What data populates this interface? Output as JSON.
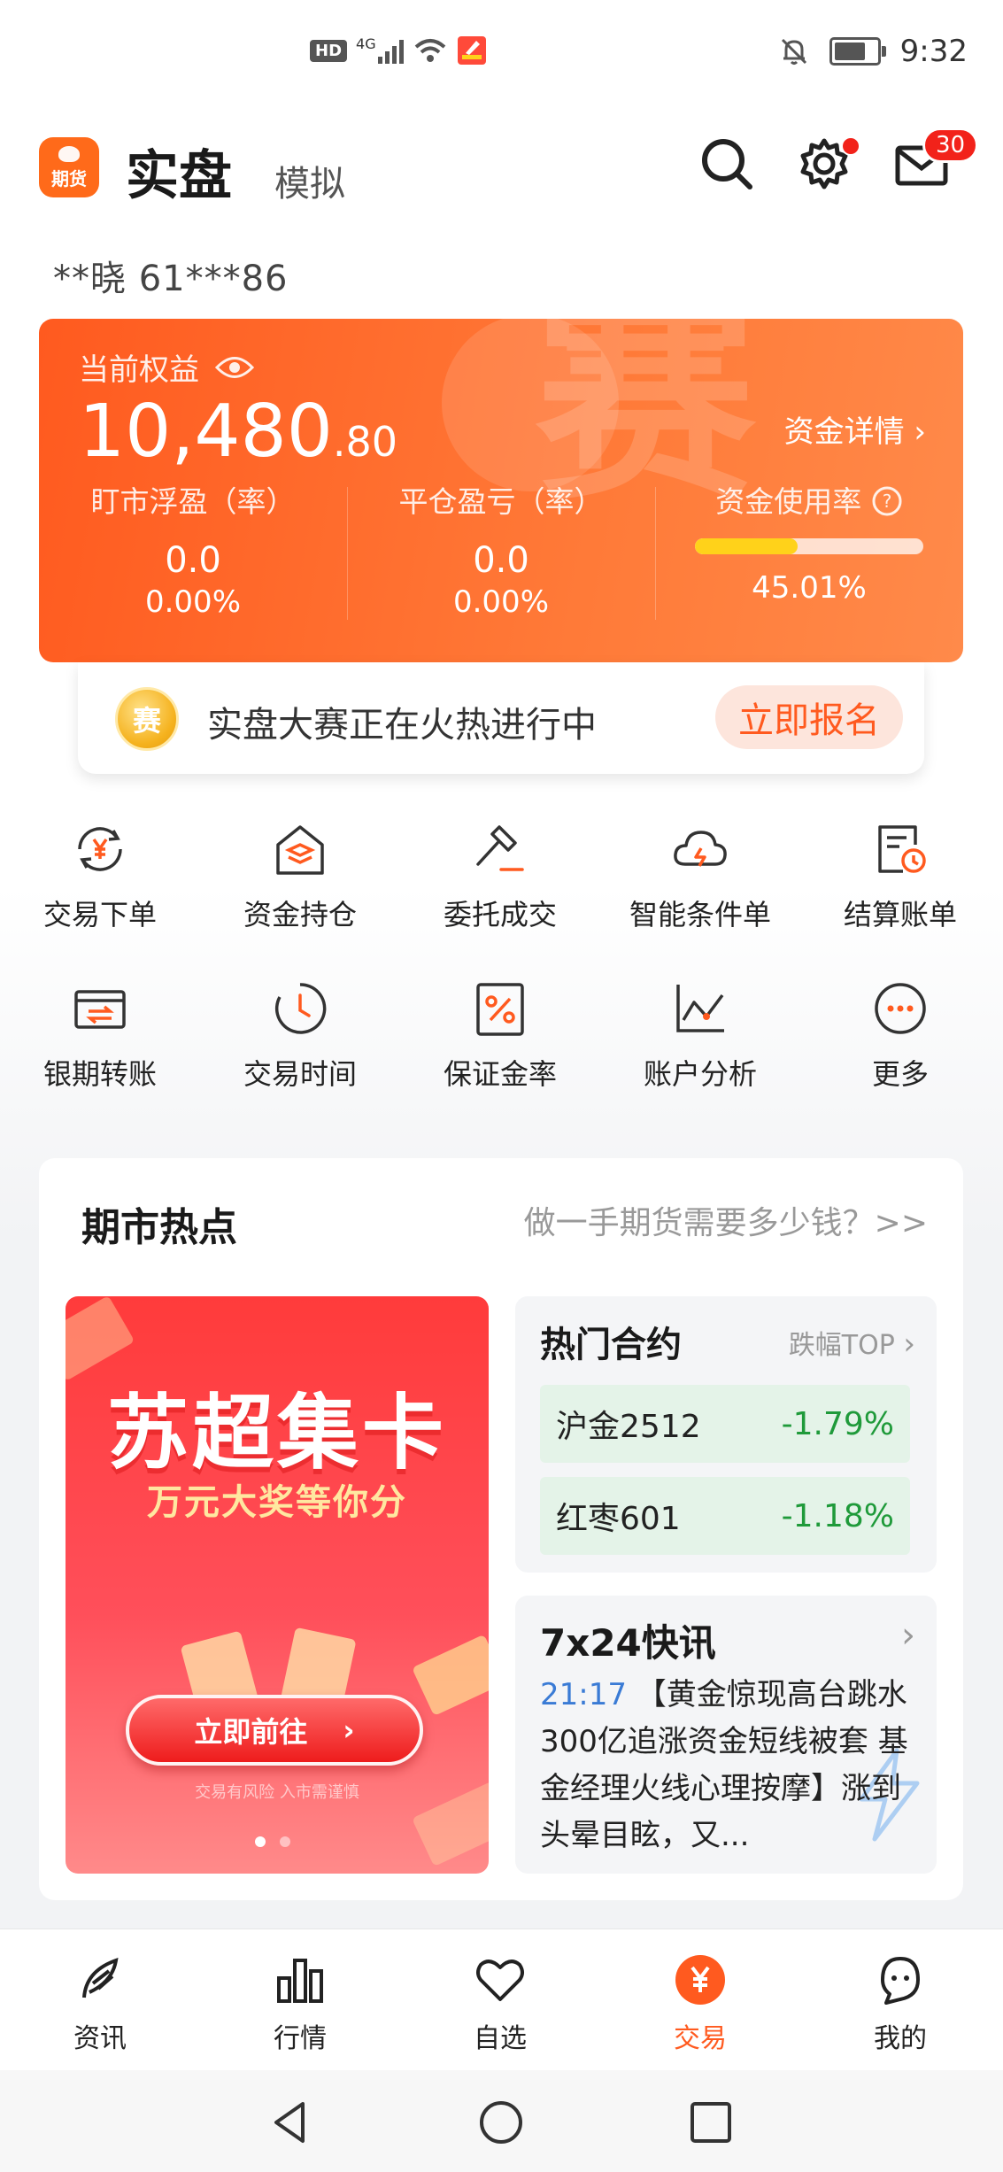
{
  "status_bar": {
    "time": "9:32",
    "hd": "HD",
    "net": "4G"
  },
  "header": {
    "logo_text": "期货",
    "tab_live": "实盘",
    "tab_sim": "模拟",
    "mail_badge": "30"
  },
  "account": "**晓  61***86",
  "equity": {
    "label": "当前权益",
    "value_int": "10,480",
    "value_dec": ".80",
    "detail_link": "资金详情 ›",
    "watermark": "赛",
    "float_pl_label": "盯市浮盈（率）",
    "float_pl_value": "0.0",
    "float_pl_rate": "0.00%",
    "close_pl_label": "平仓盈亏（率）",
    "close_pl_value": "0.0",
    "close_pl_rate": "0.00%",
    "usage_label": "资金使用率",
    "usage_value": "45.01%",
    "usage_fraction": 0.4501
  },
  "contest": {
    "medal": "赛",
    "message": "实盘大赛正在火热进行中",
    "button": "立即报名"
  },
  "shortcuts": [
    {
      "label": "交易下单",
      "icon": "yuan-exchange-icon"
    },
    {
      "label": "资金持仓",
      "icon": "house-layers-icon"
    },
    {
      "label": "委托成交",
      "icon": "gavel-icon"
    },
    {
      "label": "智能条件单",
      "icon": "cloud-lightning-icon"
    },
    {
      "label": "结算账单",
      "icon": "bill-clock-icon"
    },
    {
      "label": "银期转账",
      "icon": "card-transfer-icon"
    },
    {
      "label": "交易时间",
      "icon": "clock-icon"
    },
    {
      "label": "保证金率",
      "icon": "percent-icon"
    },
    {
      "label": "账户分析",
      "icon": "chart-line-icon"
    },
    {
      "label": "更多",
      "icon": "more-icon"
    }
  ],
  "hot_panel": {
    "title": "期市热点",
    "question": "做一手期货需要多少钱？>>",
    "banner": {
      "headline": "苏超集卡",
      "subline": "万元大奖等你分",
      "button": "立即前往",
      "disclaimer": "交易有风险 入市需谨慎"
    },
    "hot_contracts": {
      "title": "热门合约",
      "top_link": "跌幅TOP",
      "rows": [
        {
          "name": "沪金2512",
          "change": "-1.79%"
        },
        {
          "name": "红枣601",
          "change": "-1.18%"
        }
      ]
    },
    "news": {
      "title": "7x24快讯",
      "time": "21:17",
      "text": "【黄金惊现高台跳水 300亿追涨资金短线被套 基金经理火线心理按摩】涨到头晕目眩，又..."
    }
  },
  "bottom_nav": [
    {
      "label": "资讯",
      "icon": "feather-icon"
    },
    {
      "label": "行情",
      "icon": "bar-chart-icon"
    },
    {
      "label": "自选",
      "icon": "heart-icon"
    },
    {
      "label": "交易",
      "icon": "yuan-coin-icon"
    },
    {
      "label": "我的",
      "icon": "profile-face-icon"
    }
  ],
  "colors": {
    "accent": "#ff5a1f",
    "down": "#1f9a3a",
    "link_blue": "#3a7bd5"
  }
}
